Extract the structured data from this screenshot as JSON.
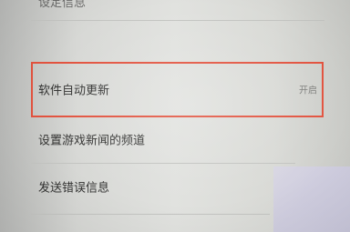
{
  "settings": {
    "top_item_partial": "设定信息",
    "auto_update": {
      "label": "软件自动更新",
      "value": "开启"
    },
    "news_channel": {
      "label": "设置游戏新闻的频道"
    },
    "error_report": {
      "label": "发送错误信息"
    }
  },
  "colors": {
    "highlight": "#e2523e",
    "background": "#dcdcd9",
    "text": "#333332"
  }
}
